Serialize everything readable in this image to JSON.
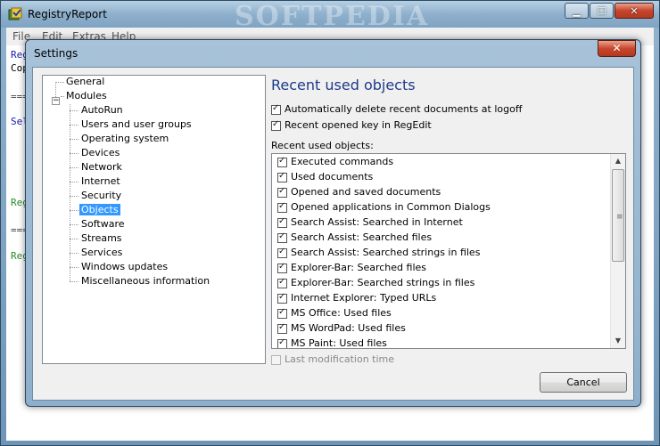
{
  "main_window": {
    "title": "RegistryReport",
    "watermark": "SOFTPEDIA",
    "menu": [
      "File",
      "Edit",
      "Extras",
      "Help"
    ],
    "background_lines": [
      "Reg",
      "Cop",
      "===",
      "Sel",
      "Reg",
      "===",
      "Reg"
    ]
  },
  "dialog": {
    "title": "Settings",
    "close_glyph": "✕",
    "tree": {
      "general": "General",
      "modules": "Modules",
      "children": [
        "AutoRun",
        "Users and user groups",
        "Operating system",
        "Devices",
        "Network",
        "Internet",
        "Security",
        "Objects",
        "Software",
        "Streams",
        "Services",
        "Windows updates",
        "Miscellaneous information"
      ],
      "selected": "Objects"
    },
    "heading": "Recent used objects",
    "options": [
      {
        "label": "Automatically delete recent documents at logoff",
        "checked": true
      },
      {
        "label": "Recent opened key in RegEdit",
        "checked": true
      }
    ],
    "list_label": "Recent used objects:",
    "list_items": [
      "Executed commands",
      "Used documents",
      "Opened and saved documents",
      "Opened applications in Common Dialogs",
      "Search Assist: Searched in Internet",
      "Search Assist: Searched files",
      "Search Assist: Searched strings in files",
      "Explorer-Bar: Searched files",
      "Explorer-Bar: Searched strings in files",
      "Internet Explorer: Typed URLs",
      "MS Office: Used files",
      "MS WordPad: Used files",
      "MS Paint: Used files"
    ],
    "last_modification": "Last modification time",
    "cancel_label": "Cancel"
  },
  "colors": {
    "heading": "#1e3a8a",
    "selection": "#3399ff"
  }
}
